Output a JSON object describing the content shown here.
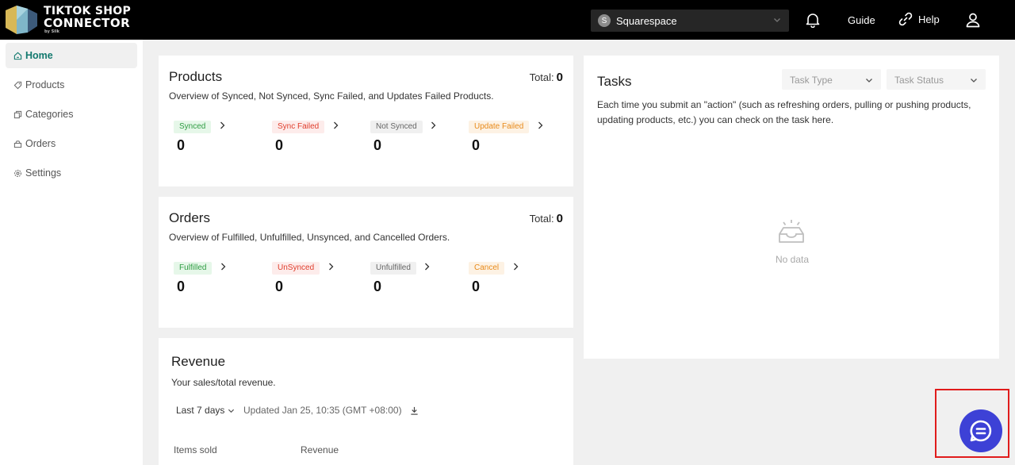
{
  "header": {
    "logo_line1": "TIKTOK SHOP",
    "logo_line2": "CONNECTOR",
    "logo_by": "by Silk",
    "store": {
      "avatar_letter": "S",
      "name": "Squarespace"
    },
    "guide_label": "Guide",
    "help_label": "Help",
    "icons": [
      "bell-icon",
      "link-icon",
      "user-icon"
    ]
  },
  "sidebar": {
    "items": [
      {
        "label": "Home",
        "icon": "home-icon",
        "active": true
      },
      {
        "label": "Products",
        "icon": "tag-icon"
      },
      {
        "label": "Categories",
        "icon": "copy-icon"
      },
      {
        "label": "Orders",
        "icon": "box-icon"
      },
      {
        "label": "Settings",
        "icon": "gear-icon"
      }
    ]
  },
  "products": {
    "title": "Products",
    "total_label": "Total:",
    "total_value": "0",
    "description": "Overview of Synced, Not Synced, Sync Failed, and Updates Failed Products.",
    "stats": [
      {
        "label": "Synced",
        "value": "0"
      },
      {
        "label": "Sync Failed",
        "value": "0"
      },
      {
        "label": "Not Synced",
        "value": "0"
      },
      {
        "label": "Update Failed",
        "value": "0"
      }
    ]
  },
  "orders": {
    "title": "Orders",
    "total_label": "Total:",
    "total_value": "0",
    "description": "Overview of Fulfilled, Unfulfilled, Unsynced, and Cancelled Orders.",
    "stats": [
      {
        "label": "Fulfilled",
        "value": "0"
      },
      {
        "label": "UnSynced",
        "value": "0"
      },
      {
        "label": "Unfulfilled",
        "value": "0"
      },
      {
        "label": "Cancel",
        "value": "0"
      }
    ]
  },
  "revenue": {
    "title": "Revenue",
    "description": "Your sales/total revenue.",
    "range": "Last 7 days",
    "updated": "Updated Jan 25, 10:35 (GMT +08:00)",
    "columns": [
      "Items sold",
      "Revenue"
    ]
  },
  "tasks": {
    "title": "Tasks",
    "type_placeholder": "Task Type",
    "status_placeholder": "Task Status",
    "description": "Each time you submit an \"action\" (such as refreshing orders, pulling or pushing products, updating products, etc.) you can check on the task here.",
    "empty_text": "No data"
  },
  "colors": {
    "accent": "#12796e",
    "chat": "#3d41d6",
    "highlight": "#e01c1c"
  }
}
